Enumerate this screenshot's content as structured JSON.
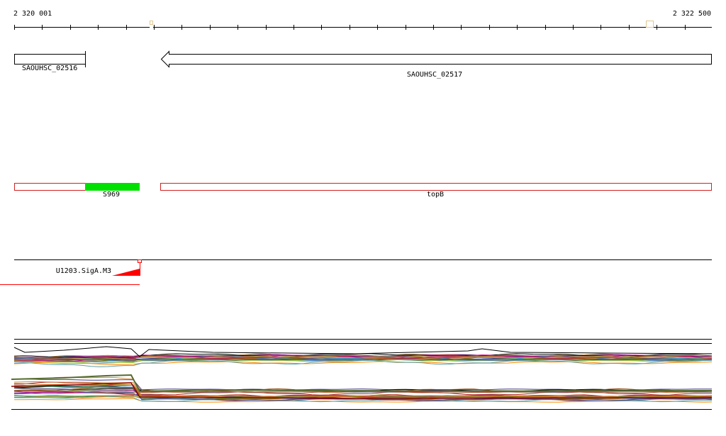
{
  "ruler": {
    "start_label": "2 320 001",
    "end_label": "2 322 500"
  },
  "genes": [
    {
      "name": "SAOUHSC_02516",
      "strand": "+"
    },
    {
      "name": "SAOUHSC_02517",
      "strand": "-"
    }
  ],
  "features": [
    {
      "name": "S969",
      "color": "#00e000"
    },
    {
      "name": "topB",
      "color": "#d42020"
    }
  ],
  "promoter": {
    "name": "U1203.SigA.M3",
    "color": "#ff0000"
  },
  "colors": {
    "axis": "#000000",
    "feature_outline": "#d42020",
    "feature_fill": "#00e000",
    "promoter": "#ff0000"
  }
}
